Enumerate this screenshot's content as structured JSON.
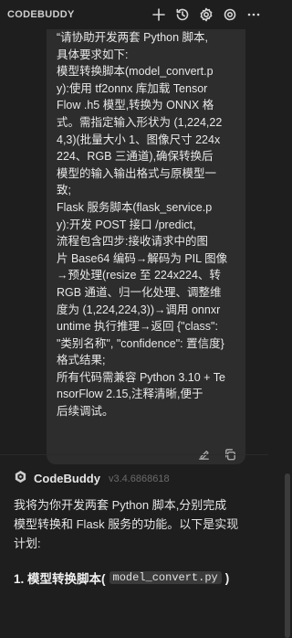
{
  "app": {
    "title": "CODEBUDDY"
  },
  "toolbar": {
    "icons": [
      "plus-icon",
      "history-icon",
      "settings-gear-icon",
      "more-icon"
    ]
  },
  "user_message": {
    "lines": [
      "“请协助开发两套 Python 脚本,",
      "具体要求如下:",
      "模型转换脚本(model_convert.p",
      "y):使用 tf2onnx 库加载 Tensor",
      "Flow .h5 模型,转换为 ONNX 格",
      "式。需指定输入形状为 (1,224,22",
      "4,3)(批量大小 1、图像尺寸 224x",
      "224、RGB 三通道),确保转换后",
      "模型的输入输出格式与原模型一",
      "致;",
      "Flask 服务脚本(flask_service.p",
      "y):开发 POST 接口 /predict,",
      "流程包含四步:接收请求中的图",
      "片 Base64 编码→解码为 PIL 图像",
      "→预处理(resize 至 224x224、转",
      "RGB 通道、归一化处理、调整维",
      "度为 (1,224,224,3))→调用 onnxr",
      "untime 执行推理→返回 {\"class\":",
      "\"类别名称\", \"confidence\": 置信度}",
      "格式结果;",
      "所有代码需兼容 Python 3.10 + Te",
      "nsorFlow 2.15,注释清晰,便于",
      "后续调试。"
    ]
  },
  "assistant": {
    "name": "CodeBuddy",
    "version": "v3.4.6868618",
    "reply_lines": [
      "我将为你开发两套 Python 脚本,分别完成",
      "模型转换和 Flask 服务的功能。以下是实现",
      "计划:"
    ],
    "heading_prefix": "1. 模型转换脚本(",
    "heading_code": "model_convert.py",
    "heading_suffix": ")"
  }
}
